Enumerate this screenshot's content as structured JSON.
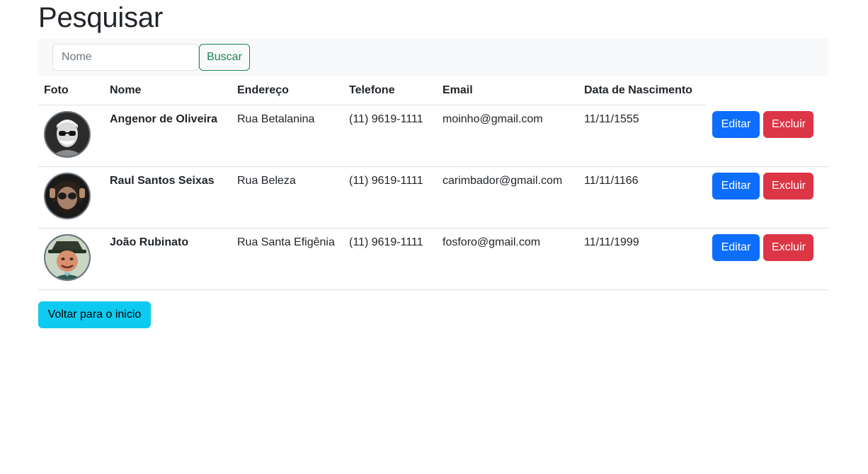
{
  "page": {
    "title": "Pesquisar",
    "back_label": "Voltar para o inicio"
  },
  "search": {
    "placeholder": "Nome",
    "value": "",
    "button_label": "Buscar"
  },
  "table": {
    "headers": {
      "photo": "Foto",
      "name": "Nome",
      "address": "Endereço",
      "phone": "Telefone",
      "email": "Email",
      "birth": "Data de Nascimento"
    },
    "rows": [
      {
        "photo_icon": "person-photo-avatar",
        "name": "Angenor de Oliveira",
        "address": "Rua Betalanina",
        "phone": "(11) 9619-1111",
        "email": "moinho@gmail.com",
        "birth": "11/11/1555",
        "edit_label": "Editar",
        "delete_label": "Excluir"
      },
      {
        "photo_icon": "person-photo-avatar",
        "name": "Raul Santos Seixas",
        "address": "Rua Beleza",
        "phone": "(11) 9619-1111",
        "email": "carimbador@gmail.com",
        "birth": "11/11/1166",
        "edit_label": "Editar",
        "delete_label": "Excluir"
      },
      {
        "photo_icon": "person-photo-avatar",
        "name": "João Rubinato",
        "address": "Rua Santa Efigênia",
        "phone": "(11) 9619-1111",
        "email": "fosforo@gmail.com",
        "birth": "11/11/1999",
        "edit_label": "Editar",
        "delete_label": "Excluir"
      }
    ]
  },
  "colors": {
    "primary": "#0d6efd",
    "danger": "#dc3545",
    "success": "#198754",
    "info": "#0dcaf0",
    "light": "#f8f9fa"
  }
}
